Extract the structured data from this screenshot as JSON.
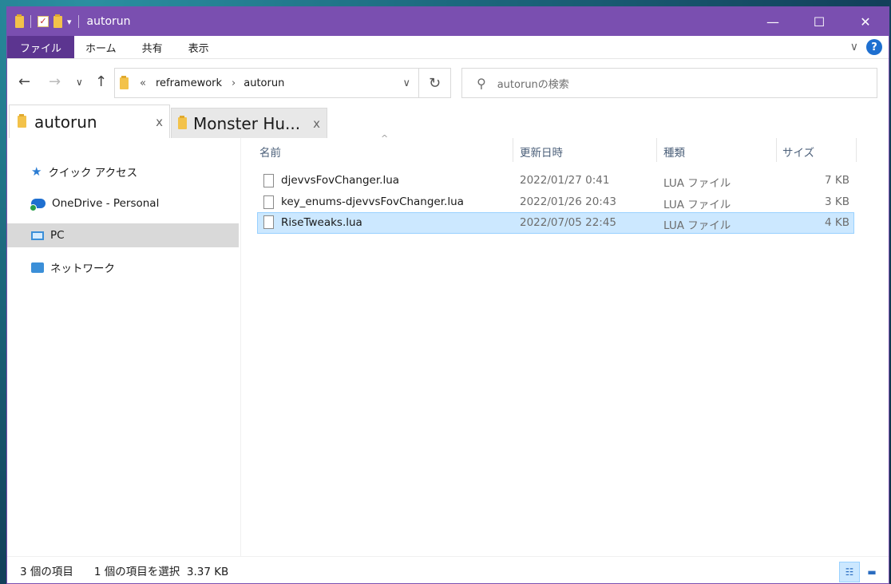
{
  "window": {
    "title": "autorun"
  },
  "titlebar": {
    "minimize": "—",
    "maximize": "☐",
    "close": "✕",
    "qa_dropdown": "▾"
  },
  "ribbon": {
    "tabs": [
      {
        "label": "ファイル"
      },
      {
        "label": "ホーム"
      },
      {
        "label": "共有"
      },
      {
        "label": "表示"
      }
    ],
    "expand": "∨",
    "help": "?"
  },
  "nav": {
    "back": "←",
    "forward": "→",
    "recent": "∨",
    "up": "↑",
    "breadcrumb_prefix": "«",
    "breadcrumb": [
      "reframework",
      "autorun"
    ],
    "breadcrumb_sep": "›",
    "addr_dropdown": "∨",
    "refresh": "↻",
    "search_icon": "⚲",
    "search_placeholder": "autorunの検索"
  },
  "folder_tabs": [
    {
      "label": "autorun",
      "close": "x"
    },
    {
      "label": "Monster Hu...",
      "close": "x"
    }
  ],
  "sidebar": {
    "items": [
      {
        "label": "クイック アクセス",
        "icon": "star-icon"
      },
      {
        "label": "OneDrive - Personal",
        "icon": "cloud-icon"
      },
      {
        "label": "PC",
        "icon": "pc-icon"
      },
      {
        "label": "ネットワーク",
        "icon": "network-icon"
      }
    ]
  },
  "columns": {
    "name": "名前",
    "date": "更新日時",
    "type": "種類",
    "size": "サイズ",
    "sort_indicator": "^"
  },
  "files": [
    {
      "name": "djevvsFovChanger.lua",
      "date": "2022/01/27 0:41",
      "type": "LUA ファイル",
      "size": "7 KB"
    },
    {
      "name": "key_enums-djevvsFovChanger.lua",
      "date": "2022/01/26 20:43",
      "type": "LUA ファイル",
      "size": "3 KB"
    },
    {
      "name": "RiseTweaks.lua",
      "date": "2022/07/05 22:45",
      "type": "LUA ファイル",
      "size": "4 KB"
    }
  ],
  "status": {
    "count": "3 個の項目",
    "selection": "1 個の項目を選択  3.37 KB",
    "details_view": "☷",
    "icons_view": "▬"
  },
  "colors": {
    "titlebar": "#7a4fb0",
    "selection": "#cce8ff",
    "accent": "#1e6fd0"
  }
}
